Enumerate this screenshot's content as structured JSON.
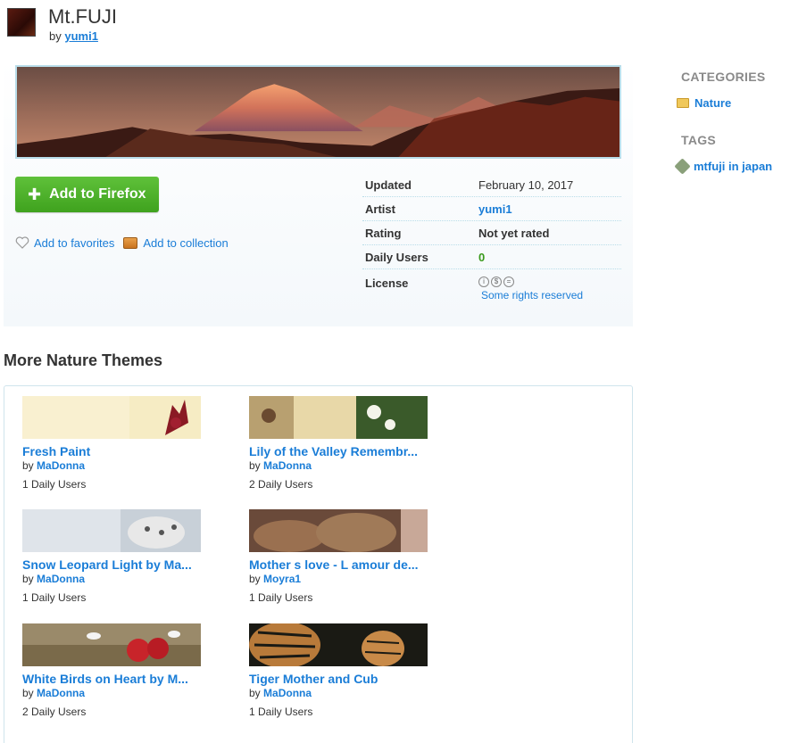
{
  "header": {
    "title": "Mt.FUJI",
    "by_label": "by",
    "author": "yumi1"
  },
  "actions": {
    "add_button": "Add to Firefox",
    "favorites": "Add to favorites",
    "collection": "Add to collection"
  },
  "meta": {
    "rows": [
      {
        "key": "Updated",
        "value": "February 10, 2017"
      },
      {
        "key": "Artist",
        "value": "yumi1"
      },
      {
        "key": "Rating",
        "value": "Not yet rated"
      },
      {
        "key": "Daily Users",
        "value": "0"
      },
      {
        "key": "License",
        "value": "Some rights reserved"
      }
    ]
  },
  "sidebar": {
    "categories_heading": "CATEGORIES",
    "category": "Nature",
    "tags_heading": "TAGS",
    "tag": "mtfuji in japan"
  },
  "more": {
    "title": "More Nature Themes",
    "themes": [
      {
        "name": "Fresh Paint",
        "by": "by",
        "author": "MaDonna",
        "users": "1 Daily Users"
      },
      {
        "name": "Lily of the Valley Remembr...",
        "by": "by",
        "author": "MaDonna",
        "users": "2 Daily Users"
      },
      {
        "name": "Snow Leopard Light by Ma...",
        "by": "by",
        "author": "MaDonna",
        "users": "1 Daily Users"
      },
      {
        "name": "Mother s love - L amour de...",
        "by": "by",
        "author": "Moyra1",
        "users": "1 Daily Users"
      },
      {
        "name": "White Birds on Heart by M...",
        "by": "by",
        "author": "MaDonna",
        "users": "2 Daily Users"
      },
      {
        "name": "Tiger Mother and Cub",
        "by": "by",
        "author": "MaDonna",
        "users": "1 Daily Users"
      }
    ]
  }
}
